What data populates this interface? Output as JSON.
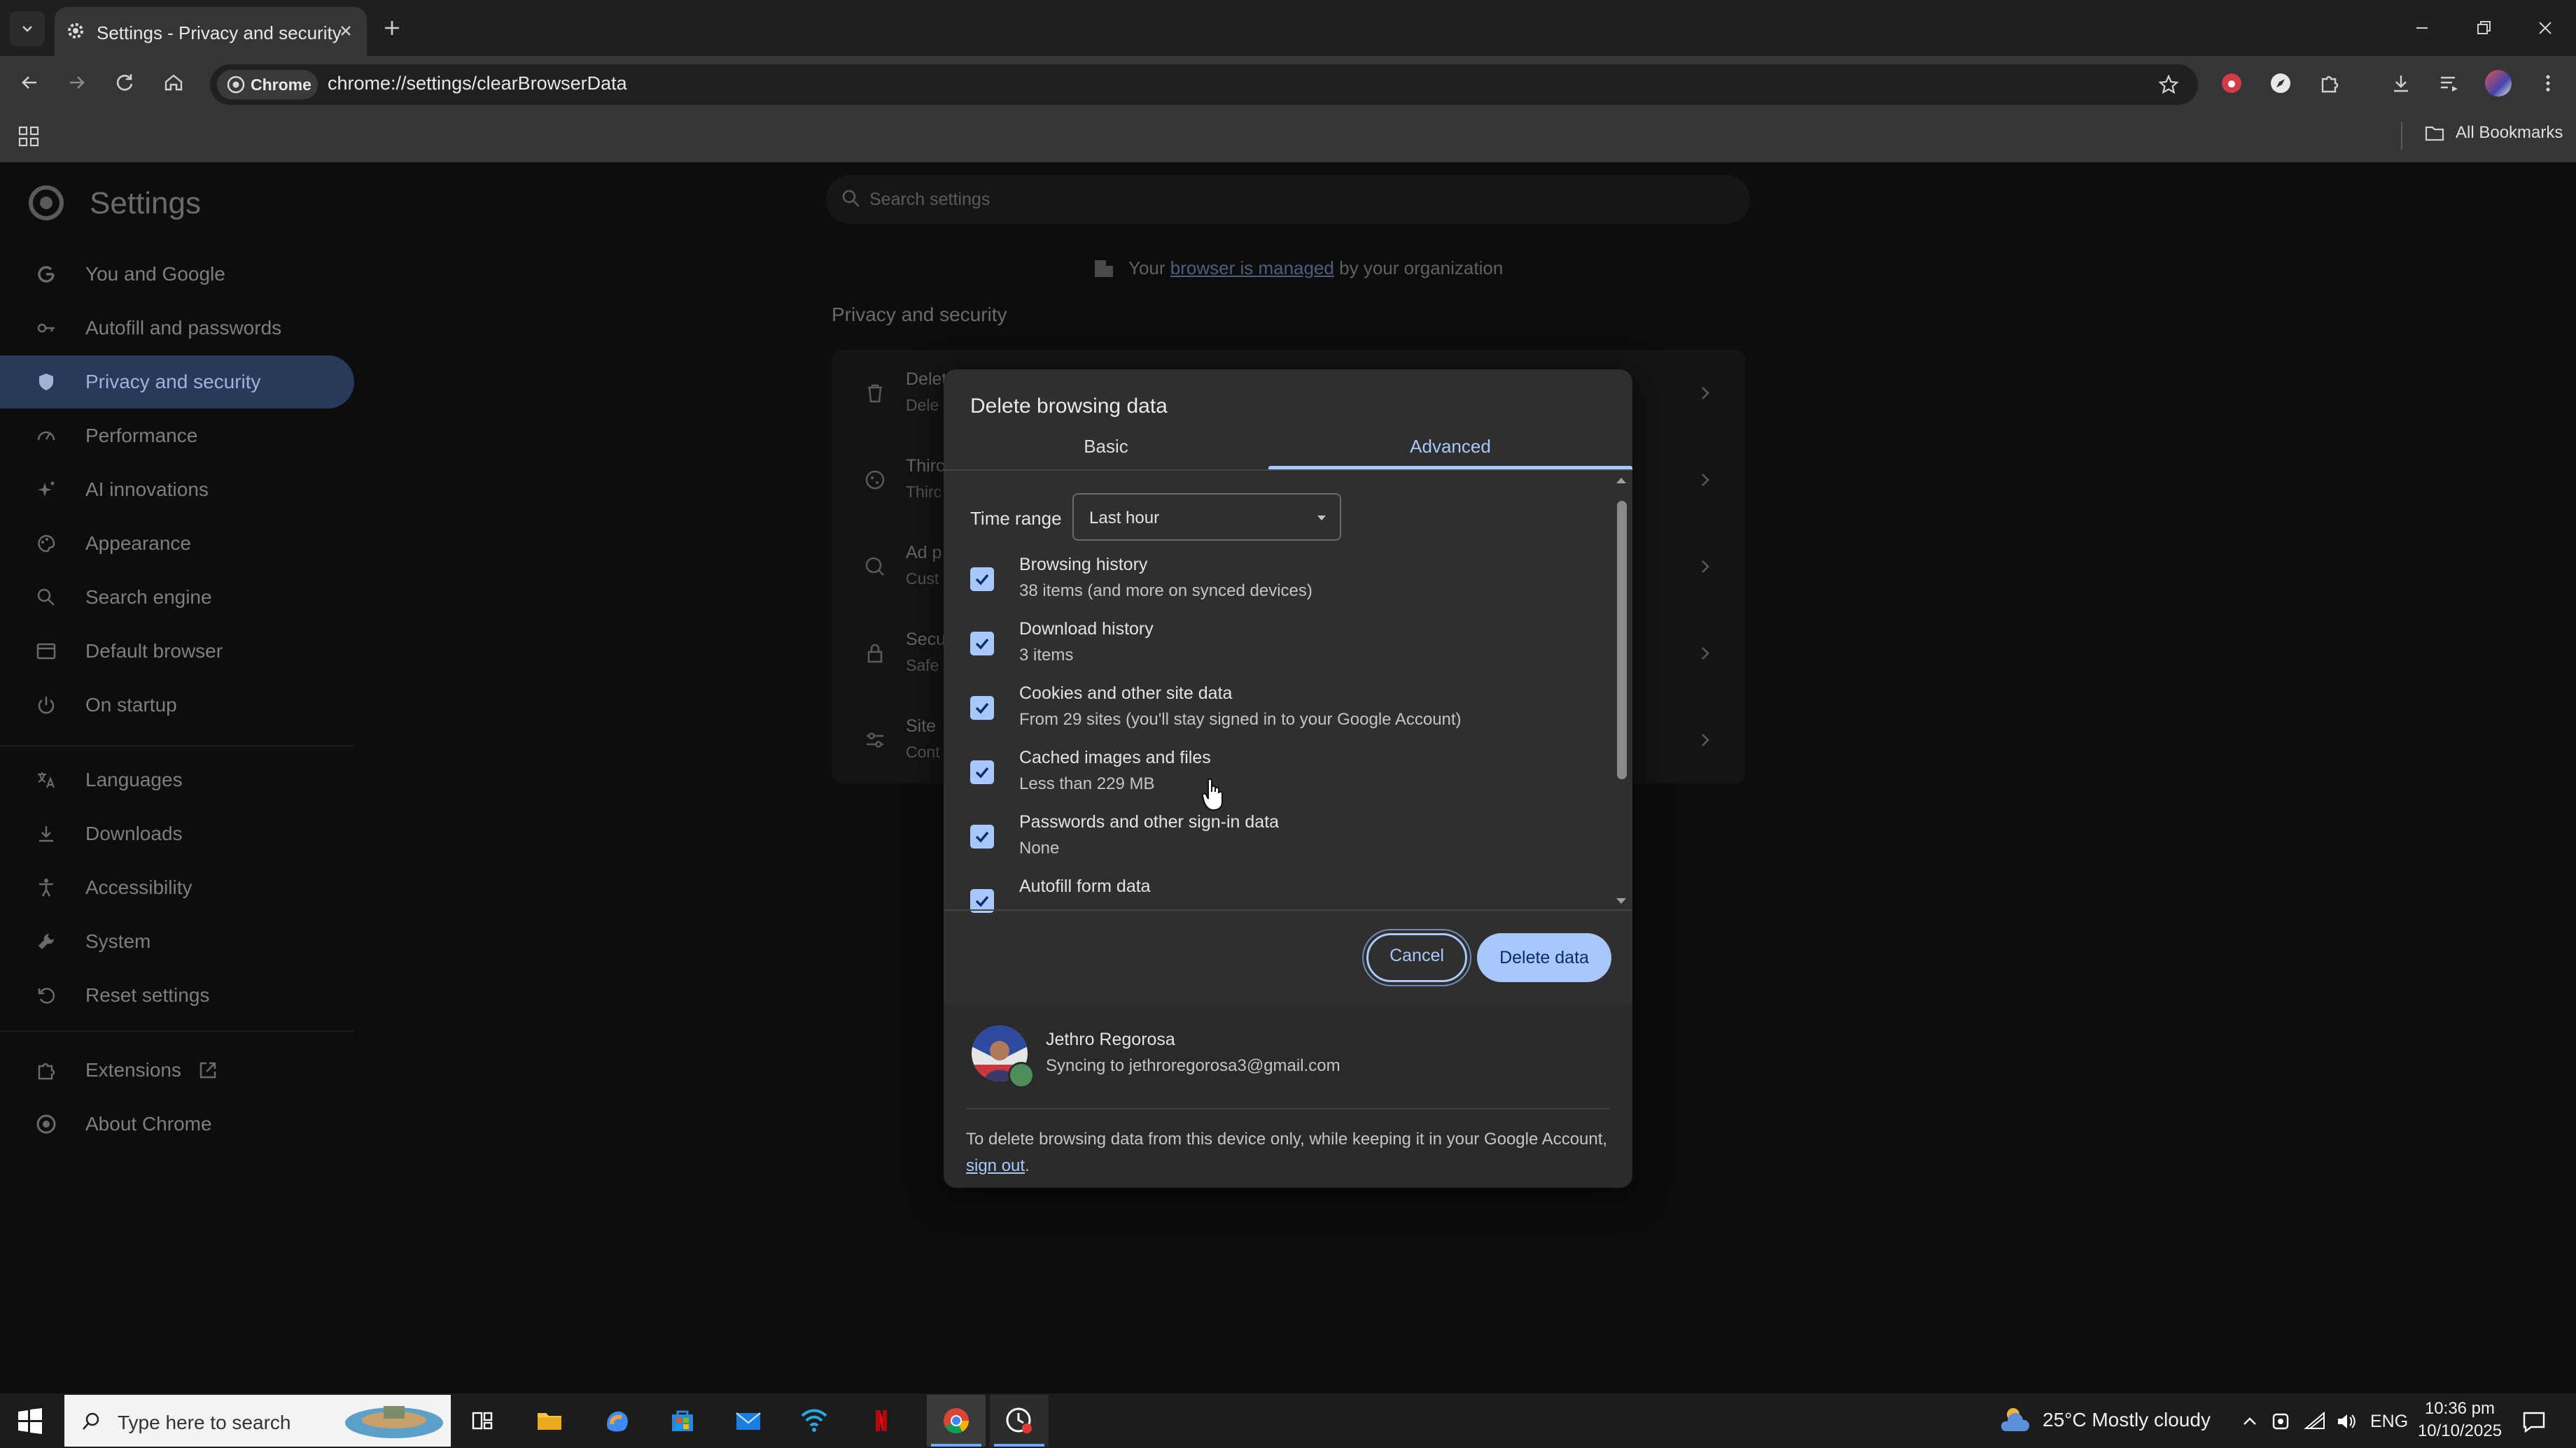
{
  "browser": {
    "tab_title": "Settings - Privacy and security",
    "site_chip": "Chrome",
    "url": "chrome://settings/clearBrowserData",
    "all_bookmarks": "All Bookmarks"
  },
  "settings": {
    "title": "Settings",
    "search_placeholder": "Search settings",
    "managed_prefix": "Your",
    "managed_link": "browser is managed",
    "managed_suffix": "by your organization",
    "section_heading": "Privacy and security",
    "nav": [
      {
        "label": "You and Google",
        "icon": "google-icon"
      },
      {
        "label": "Autofill and passwords",
        "icon": "key-icon"
      },
      {
        "label": "Privacy and security",
        "icon": "shield-icon",
        "active": true
      },
      {
        "label": "Performance",
        "icon": "speedometer-icon"
      },
      {
        "label": "AI innovations",
        "icon": "sparkle-icon"
      },
      {
        "label": "Appearance",
        "icon": "palette-icon"
      },
      {
        "label": "Search engine",
        "icon": "search-icon"
      },
      {
        "label": "Default browser",
        "icon": "browser-window-icon"
      },
      {
        "label": "On startup",
        "icon": "power-icon"
      },
      {
        "label": "Languages",
        "icon": "translate-icon"
      },
      {
        "label": "Downloads",
        "icon": "download-icon"
      },
      {
        "label": "Accessibility",
        "icon": "accessibility-icon"
      },
      {
        "label": "System",
        "icon": "wrench-icon"
      },
      {
        "label": "Reset settings",
        "icon": "reset-icon"
      },
      {
        "label": "Extensions",
        "icon": "puzzle-icon"
      },
      {
        "label": "About Chrome",
        "icon": "chrome-icon"
      }
    ],
    "privacy_rows": [
      {
        "title": "Delet",
        "sub": "Dele",
        "icon": "trash-icon"
      },
      {
        "title": "Thirc",
        "sub": "Thirc",
        "icon": "cookie-icon"
      },
      {
        "title": "Ad p",
        "sub": "Cust",
        "icon": "ad-icon"
      },
      {
        "title": "Secu",
        "sub": "Safe",
        "icon": "lock-icon"
      },
      {
        "title": "Site",
        "sub": "Cont",
        "icon": "sliders-icon"
      }
    ]
  },
  "dialog": {
    "title": "Delete browsing data",
    "tabs": {
      "basic": "Basic",
      "advanced": "Advanced"
    },
    "time_range_label": "Time range",
    "time_range_value": "Last hour",
    "items": [
      {
        "title": "Browsing history",
        "sub": "38 items (and more on synced devices)",
        "checked": true
      },
      {
        "title": "Download history",
        "sub": "3 items",
        "checked": true
      },
      {
        "title": "Cookies and other site data",
        "sub": "From 29 sites (you'll stay signed in to your Google Account)",
        "checked": true
      },
      {
        "title": "Cached images and files",
        "sub": "Less than 229 MB",
        "checked": true
      },
      {
        "title": "Passwords and other sign-in data",
        "sub": "None",
        "checked": true
      },
      {
        "title": "Autofill form data",
        "sub": "",
        "checked": true
      }
    ],
    "cancel_label": "Cancel",
    "delete_label": "Delete data",
    "account": {
      "name": "Jethro Regorosa",
      "sync": "Syncing to jethroregorosa3@gmail.com"
    },
    "signout_note_prefix": "To delete browsing data from this device only, while keeping it in your Google Account,",
    "signout_link": "sign out",
    "signout_note_suffix": "."
  },
  "taskbar": {
    "search_placeholder": "Type here to search",
    "weather": "25°C  Mostly cloudy",
    "lang": "ENG",
    "time": "10:36 pm",
    "date": "10/10/2025"
  },
  "colors": {
    "accent": "#a8c7fa",
    "dialog_bg": "#2f2f2f",
    "active_nav": "#273a5a"
  }
}
